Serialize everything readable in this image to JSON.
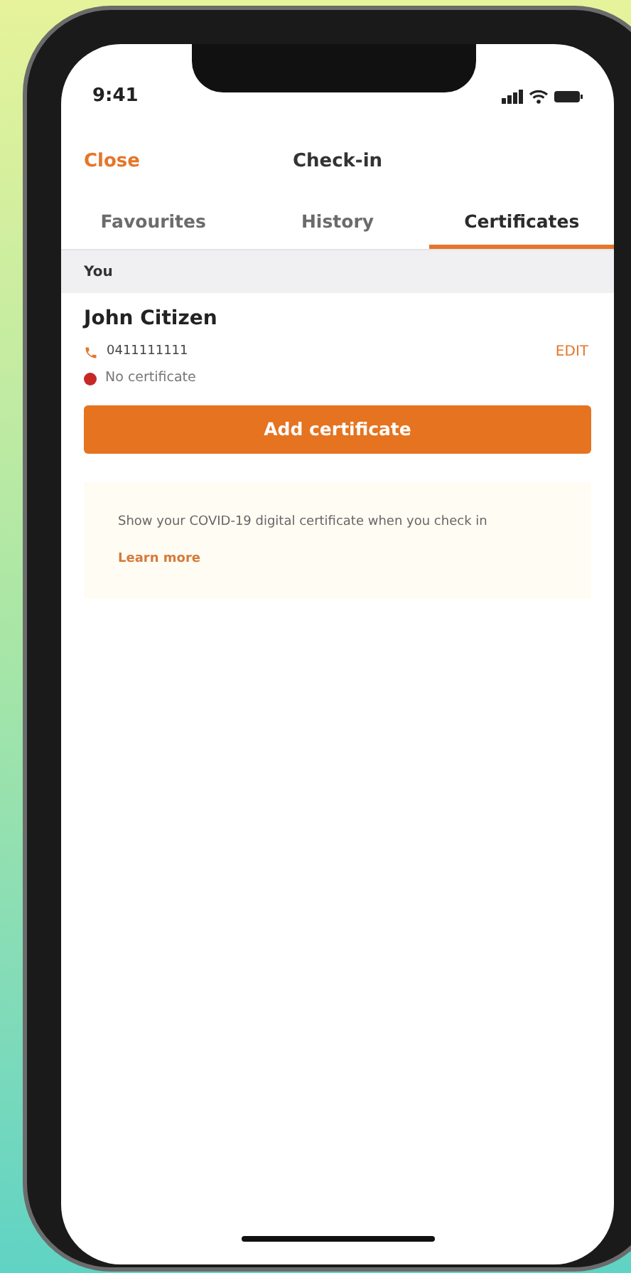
{
  "status_bar": {
    "time": "9:41"
  },
  "header": {
    "close": "Close",
    "title": "Check-in"
  },
  "tabs": [
    {
      "label": "Favourites",
      "selected": false
    },
    {
      "label": "History",
      "selected": false
    },
    {
      "label": "Certificates",
      "selected": true
    }
  ],
  "section": {
    "title": "You"
  },
  "person": {
    "name": "John Citizen",
    "phone": "0411111111",
    "edit": "EDIT",
    "status": {
      "text": "No certificate",
      "color": "#c62828"
    }
  },
  "primary_button": "Add certificate",
  "info": {
    "text": "Show your COVID-19 digital certificate when you check in",
    "link": "Learn more"
  }
}
